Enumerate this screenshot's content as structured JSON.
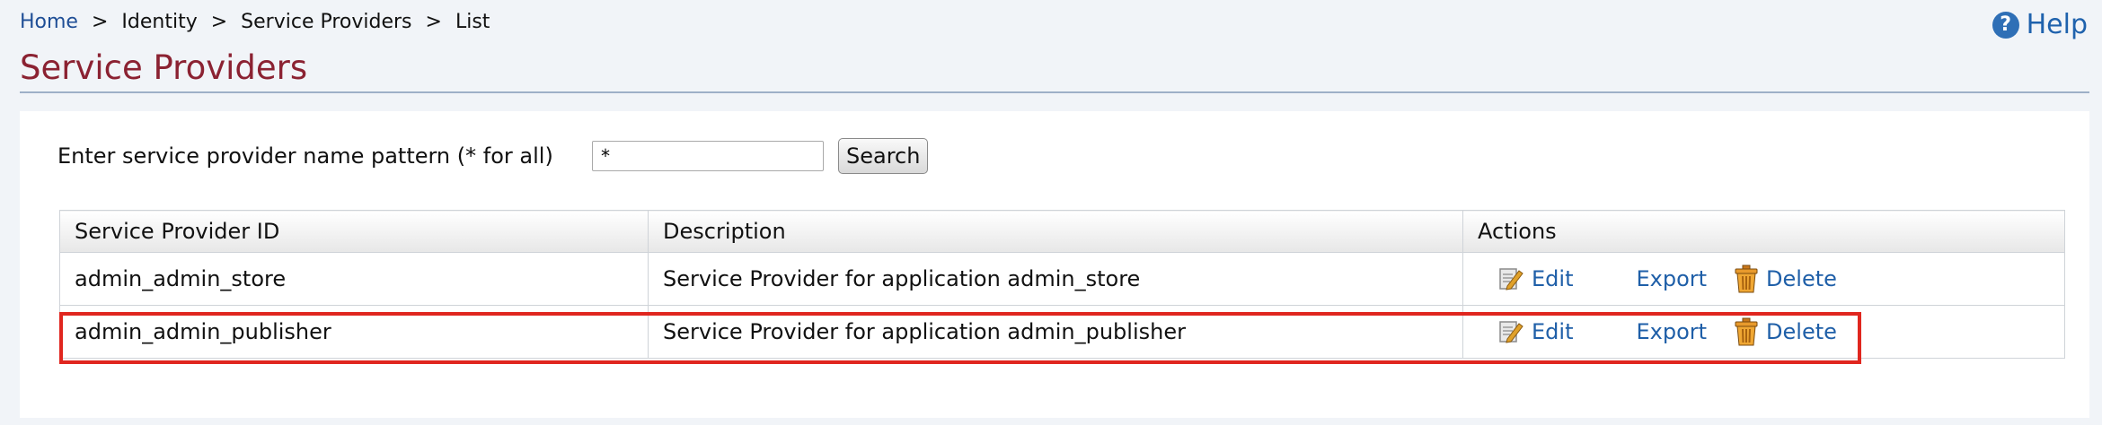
{
  "breadcrumb": {
    "home": "Home",
    "separator": ">",
    "items": [
      "Identity",
      "Service Providers",
      "List"
    ]
  },
  "help": {
    "label": "Help",
    "icon": "help-icon"
  },
  "page": {
    "title": "Service Providers"
  },
  "search": {
    "label": "Enter service provider name pattern (* for all)",
    "value": "*",
    "button_label": "Search"
  },
  "table": {
    "headers": [
      "Service Provider ID",
      "Description",
      "Actions"
    ],
    "rows": [
      {
        "id": "admin_admin_store",
        "description": "Service Provider for application admin_store"
      },
      {
        "id": "admin_admin_publisher",
        "description": "Service Provider for application admin_publisher"
      }
    ],
    "actions": {
      "edit": "Edit",
      "export": "Export",
      "delete": "Delete"
    }
  },
  "colors": {
    "title": "#8b2232",
    "link": "#1f5fa8",
    "highlight": "#e0261f",
    "background": "#f1f4f8"
  }
}
